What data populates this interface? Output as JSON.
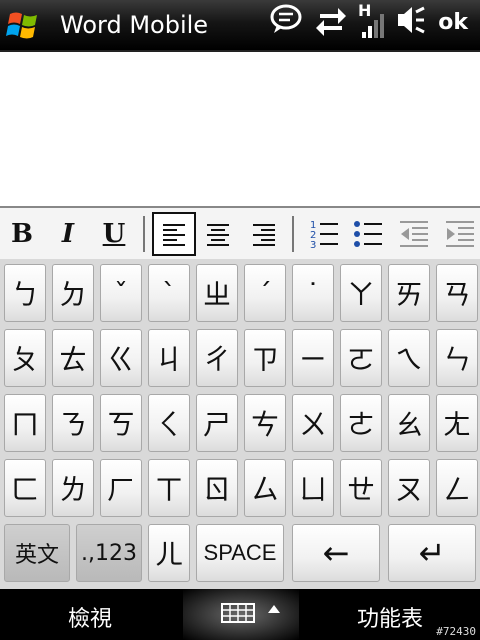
{
  "title_bar": {
    "app_title": "Word Mobile",
    "ok_label": "ok",
    "signal_label": "H"
  },
  "toolbar": {
    "bold": "B",
    "italic": "I",
    "underline": "U"
  },
  "keyboard": {
    "rows": [
      [
        "ㄅ",
        "ㄉ",
        "ˇ",
        "ˋ",
        "ㄓ",
        "ˊ",
        "˙",
        "ㄚ",
        "ㄞ",
        "ㄢ"
      ],
      [
        "ㄆ",
        "ㄊ",
        "ㄍ",
        "ㄐ",
        "ㄔ",
        "ㄗ",
        "ㄧ",
        "ㄛ",
        "ㄟ",
        "ㄣ"
      ],
      [
        "ㄇ",
        "ㄋ",
        "ㄎ",
        "ㄑ",
        "ㄕ",
        "ㄘ",
        "ㄨ",
        "ㄜ",
        "ㄠ",
        "ㄤ"
      ],
      [
        "ㄈ",
        "ㄌ",
        "ㄏ",
        "ㄒ",
        "ㄖ",
        "ㄙ",
        "ㄩ",
        "ㄝ",
        "ㄡ",
        "ㄥ"
      ]
    ],
    "bottom": {
      "english": "英文",
      "numbers": ".,123",
      "er": "ㄦ",
      "space": "SPACE",
      "backspace": "←",
      "enter": "↵"
    }
  },
  "bottom_bar": {
    "left_softkey": "檢視",
    "right_softkey": "功能表"
  },
  "watermark": "#72430",
  "colors": {
    "title_bg": "#000000",
    "keyboard_bg": "#d9d9d9",
    "accent_blue": "#1f4fa8"
  }
}
